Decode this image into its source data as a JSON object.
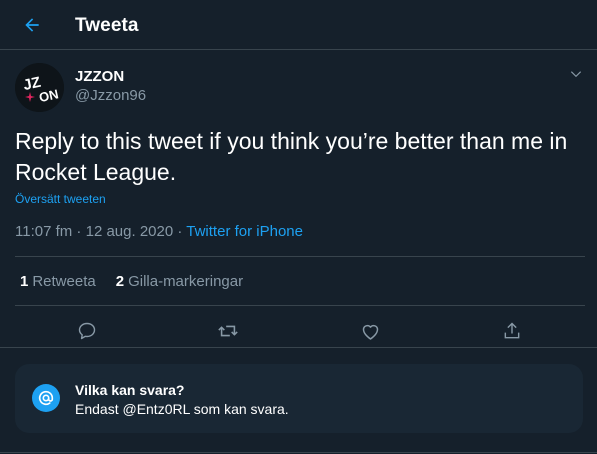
{
  "header": {
    "title": "Tweeta",
    "back_icon": "arrow-left-icon"
  },
  "tweet": {
    "author": {
      "name": "JZZON",
      "handle": "@Jzzon96",
      "avatar_text_top": "JZ",
      "avatar_text_bottom": "ON"
    },
    "text": "Reply to this tweet if you think you’re better than me in Rocket League.",
    "translate_label": "Översätt tweeten",
    "time": "11:07 fm",
    "date": "12 aug. 2020",
    "separator": " · ",
    "source": "Twitter for iPhone",
    "retweets": {
      "count": "1",
      "label": "Retweeta"
    },
    "likes": {
      "count": "2",
      "label": "Gilla-markeringar"
    }
  },
  "actions": [
    "reply-icon",
    "retweet-icon",
    "like-icon",
    "share-icon"
  ],
  "reply_restriction": {
    "title": "Vilka kan svara?",
    "subtitle": "Endast @Entz0RL som kan svara."
  },
  "colors": {
    "background": "#15202b",
    "accent": "#1da1f2",
    "secondary_text": "#8899a6",
    "border": "#38444d",
    "card": "#192734"
  }
}
